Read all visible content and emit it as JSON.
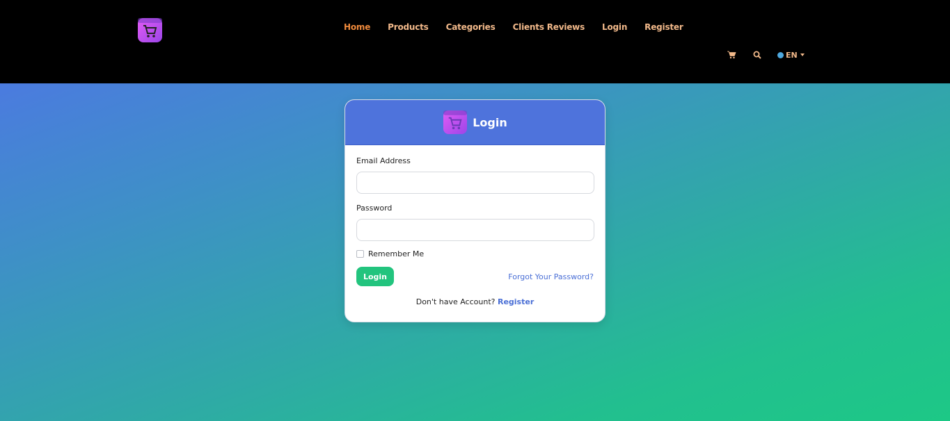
{
  "header": {
    "nav": [
      {
        "label": "Home",
        "active": true
      },
      {
        "label": "Products"
      },
      {
        "label": "Categories"
      },
      {
        "label": "Clients Reviews"
      },
      {
        "label": "Login"
      },
      {
        "label": "Register"
      }
    ],
    "tools": {
      "cart_icon": "cart-icon",
      "search_icon": "search-icon",
      "language": "EN"
    }
  },
  "colors": {
    "nav_text": "#f2b98a",
    "nav_active": "#f08a3c",
    "card_header": "#4e73dc",
    "login_button": "#22c47e",
    "link": "#4a6fd6"
  },
  "login_card": {
    "title": "Login",
    "email_label": "Email Address",
    "email_value": "",
    "password_label": "Password",
    "password_value": "",
    "remember_label": "Remember Me",
    "remember_checked": false,
    "login_button": "Login",
    "forgot_link": "Forgot Your Password?",
    "no_account_text": "Don't have Account?",
    "register_link": "Register"
  }
}
